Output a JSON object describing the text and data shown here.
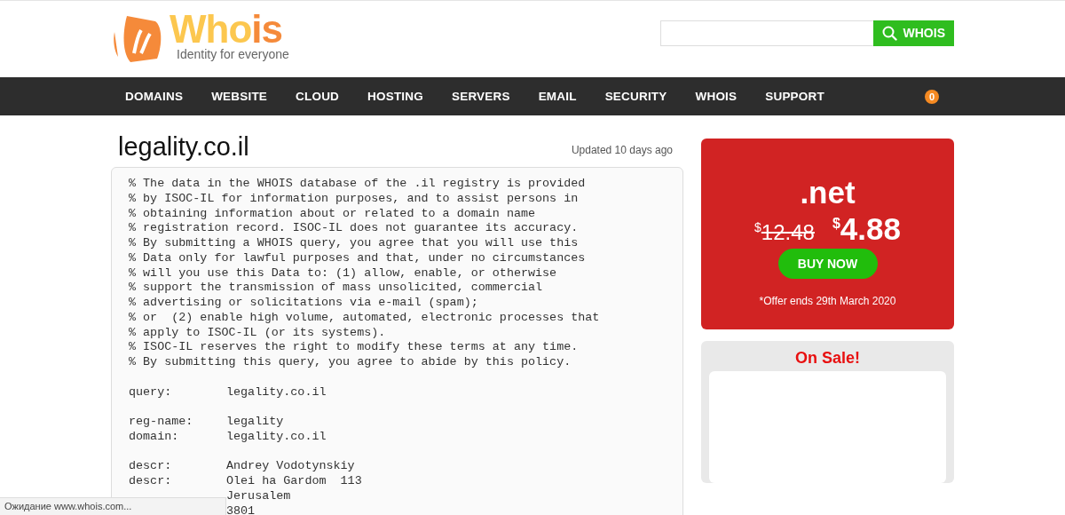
{
  "logo": {
    "word_parts": [
      "Who",
      "is"
    ],
    "tagline": "Identity for everyone"
  },
  "search": {
    "button": "WHOIS"
  },
  "nav": {
    "items": [
      "DOMAINS",
      "WEBSITE",
      "CLOUD",
      "HOSTING",
      "SERVERS",
      "EMAIL",
      "SECURITY",
      "WHOIS",
      "SUPPORT"
    ],
    "cart_count": "0"
  },
  "page": {
    "title": "legality.co.il",
    "updated": "Updated 10 days ago"
  },
  "whois": {
    "notice": [
      "% The data in the WHOIS database of the .il registry is provided",
      "% by ISOC-IL for information purposes, and to assist persons in",
      "% obtaining information about or related to a domain name",
      "% registration record. ISOC-IL does not guarantee its accuracy.",
      "% By submitting a WHOIS query, you agree that you will use this",
      "% Data only for lawful purposes and that, under no circumstances",
      "% will you use this Data to: (1) allow, enable, or otherwise",
      "% support the transmission of mass unsolicited, commercial",
      "% advertising or solicitations via e-mail (spam);",
      "% or  (2) enable high volume, automated, electronic processes that",
      "% apply to ISOC-IL (or its systems).",
      "% ISOC-IL reserves the right to modify these terms at any time.",
      "% By submitting this query, you agree to abide by this policy."
    ],
    "groups": [
      [
        {
          "label": "query:",
          "value": "legality.co.il"
        }
      ],
      [
        {
          "label": "reg-name:",
          "value": "legality"
        },
        {
          "label": "domain:",
          "value": "legality.co.il"
        }
      ],
      [
        {
          "label": "descr:",
          "value": "Andrey Vodotynskiy"
        },
        {
          "label": "descr:",
          "value": "Olei ha Gardom  113"
        },
        {
          "value": "Jerusalem"
        },
        {
          "value": "3801"
        }
      ]
    ]
  },
  "promo": {
    "tld": ".net",
    "currency": "$",
    "old_price": "12.48",
    "new_price": "4.88",
    "button": "BUY NOW",
    "note": "*Offer ends 29th March 2020"
  },
  "sale": {
    "title": "On Sale!"
  },
  "status_bar": "Ожидание www.whois.com..."
}
